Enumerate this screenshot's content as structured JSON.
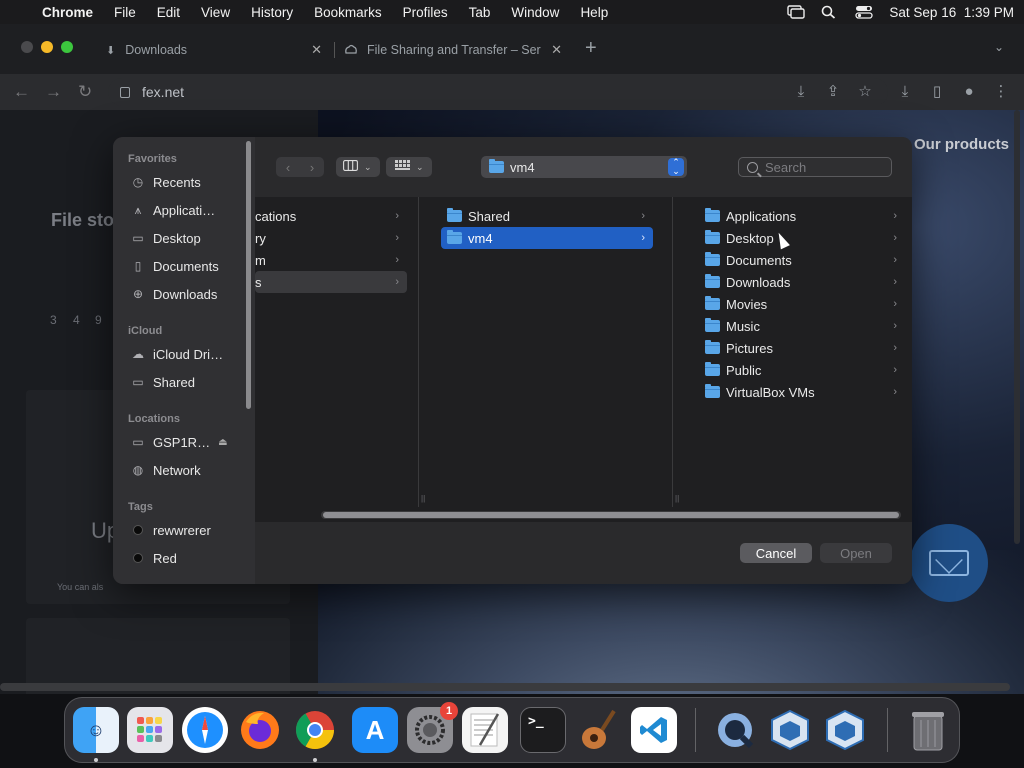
{
  "menubar": {
    "apple_icon": "apple-logo",
    "app_name": "Chrome",
    "items": [
      "File",
      "Edit",
      "View",
      "History",
      "Bookmarks",
      "Profiles",
      "Tab",
      "Window",
      "Help"
    ],
    "datetime": "Sat Sep 16  1:39 PM"
  },
  "browser": {
    "tabs": [
      {
        "label": "Downloads",
        "icon": "download-icon"
      },
      {
        "label": "File Sharing and Transfer – Ser",
        "icon": "fex-logo-icon"
      }
    ],
    "url": "fex.net"
  },
  "page": {
    "heading_partial": "File sto",
    "nav_partial": "Our products",
    "numbers": [
      "3",
      "4",
      "9"
    ],
    "upload_partial": "Up",
    "small_partial": "You can als"
  },
  "dialog": {
    "path_popup": "vm4",
    "search_placeholder": "Search",
    "sidebar": {
      "favorites_title": "Favorites",
      "favorites": [
        {
          "label": "Recents",
          "icon": "clock-icon"
        },
        {
          "label": "Applicati…",
          "icon": "applications-icon"
        },
        {
          "label": "Desktop",
          "icon": "desktop-icon"
        },
        {
          "label": "Documents",
          "icon": "document-icon"
        },
        {
          "label": "Downloads",
          "icon": "download-circle-icon"
        }
      ],
      "icloud_title": "iCloud",
      "icloud": [
        {
          "label": "iCloud Dri…",
          "icon": "cloud-icon"
        },
        {
          "label": "Shared",
          "icon": "shared-folder-icon"
        }
      ],
      "locations_title": "Locations",
      "locations": [
        {
          "label": "GSP1R…",
          "icon": "drive-icon",
          "eject": "eject-icon"
        },
        {
          "label": "Network",
          "icon": "network-icon"
        }
      ],
      "tags_title": "Tags",
      "tags": [
        {
          "label": "rewwrerer",
          "color": "#000000"
        },
        {
          "label": "Red",
          "color": "#000000"
        }
      ]
    },
    "column1": [
      {
        "label": "cations"
      },
      {
        "label": "ry"
      },
      {
        "label": "m"
      },
      {
        "label": "s",
        "state": "inactive-selected"
      }
    ],
    "column2": [
      {
        "label": "Shared"
      },
      {
        "label": "vm4",
        "state": "selected"
      }
    ],
    "column3": [
      {
        "label": "Applications"
      },
      {
        "label": "Desktop"
      },
      {
        "label": "Documents"
      },
      {
        "label": "Downloads"
      },
      {
        "label": "Movies"
      },
      {
        "label": "Music"
      },
      {
        "label": "Pictures"
      },
      {
        "label": "Public"
      },
      {
        "label": "VirtualBox VMs"
      }
    ],
    "cancel_label": "Cancel",
    "open_label": "Open"
  },
  "dock": {
    "apps": [
      {
        "name": "Finder",
        "icon": "finder-icon",
        "color": "#2d8ef0",
        "running": true
      },
      {
        "name": "Launchpad",
        "icon": "launchpad-icon",
        "color": "#e5e5ea",
        "running": false
      },
      {
        "name": "Safari",
        "icon": "safari-icon",
        "color": "#1e90ff",
        "running": false
      },
      {
        "name": "Firefox",
        "icon": "firefox-icon",
        "color": "#ff7a1a",
        "running": false
      },
      {
        "name": "Chrome",
        "icon": "chrome-icon",
        "color": "#f0f0f0",
        "running": true
      },
      {
        "name": "App Store",
        "icon": "app-store-icon",
        "color": "#1d8cf8",
        "running": false
      },
      {
        "name": "System Settings",
        "icon": "settings-icon",
        "color": "#8e8e93",
        "running": false,
        "badge": "1"
      },
      {
        "name": "TextEdit",
        "icon": "textedit-icon",
        "color": "#f4f4f4",
        "running": false
      },
      {
        "name": "Terminal",
        "icon": "terminal-icon",
        "color": "#1c1c1e",
        "running": false
      },
      {
        "name": "GarageBand",
        "icon": "garageband-icon",
        "color": "#c8783a",
        "running": false
      },
      {
        "name": "VS Code",
        "icon": "vscode-icon",
        "color": "#ffffff",
        "running": false
      },
      {
        "name": "QuickTime",
        "icon": "quicktime-icon",
        "color": "#2a6bd1",
        "running": false
      },
      {
        "name": "VirtualBox",
        "icon": "virtualbox-icon",
        "color": "#2e6db4",
        "running": false
      },
      {
        "name": "VirtualBox 2",
        "icon": "virtualbox-icon",
        "color": "#2e6db4",
        "running": false
      },
      {
        "name": "Trash",
        "icon": "trash-icon",
        "color": "#8a8a8e",
        "running": false
      }
    ]
  }
}
